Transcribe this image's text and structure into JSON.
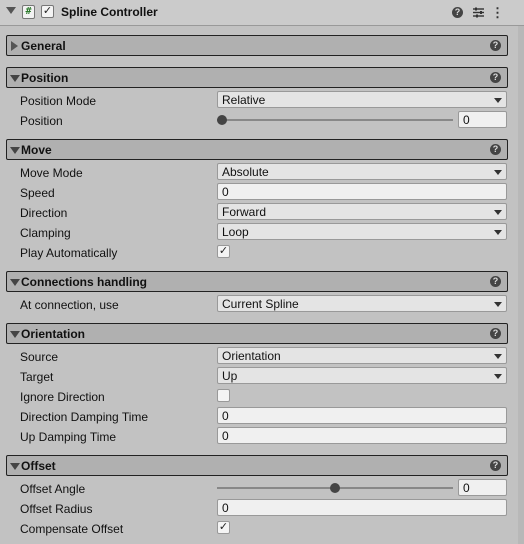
{
  "component": {
    "title": "Spline Controller",
    "script_glyph": "#",
    "enabled_glyph": "✓",
    "help_glyph": "?",
    "menu_glyph": "⋮"
  },
  "sections": {
    "general": {
      "label": "General",
      "expanded": false
    },
    "position": {
      "label": "Position",
      "expanded": true
    },
    "move": {
      "label": "Move",
      "expanded": true
    },
    "connections": {
      "label": "Connections handling",
      "expanded": true
    },
    "orientation": {
      "label": "Orientation",
      "expanded": true
    },
    "offset": {
      "label": "Offset",
      "expanded": true
    }
  },
  "position": {
    "mode": {
      "label": "Position Mode",
      "value": "Relative"
    },
    "position": {
      "label": "Position",
      "value": "0",
      "slider_fraction": 0.0
    }
  },
  "move": {
    "mode": {
      "label": "Move Mode",
      "value": "Absolute"
    },
    "speed": {
      "label": "Speed",
      "value": "0"
    },
    "direction": {
      "label": "Direction",
      "value": "Forward"
    },
    "clamping": {
      "label": "Clamping",
      "value": "Loop"
    },
    "play": {
      "label": "Play Automatically",
      "checked": true,
      "glyph": "✓"
    }
  },
  "connections": {
    "use": {
      "label": "At connection, use",
      "value": "Current Spline"
    }
  },
  "orientation": {
    "source": {
      "label": "Source",
      "value": "Orientation"
    },
    "target": {
      "label": "Target",
      "value": "Up"
    },
    "ignore": {
      "label": "Ignore Direction",
      "checked": false
    },
    "damping": {
      "label": "Direction Damping Time",
      "value": "0"
    },
    "up_damping": {
      "label": "Up Damping Time",
      "value": "0"
    }
  },
  "offset": {
    "angle": {
      "label": "Offset Angle",
      "value": "0",
      "slider_fraction": 0.5
    },
    "radius": {
      "label": "Offset Radius",
      "value": "0"
    },
    "compensate": {
      "label": "Compensate Offset",
      "checked": true,
      "glyph": "✓"
    }
  }
}
